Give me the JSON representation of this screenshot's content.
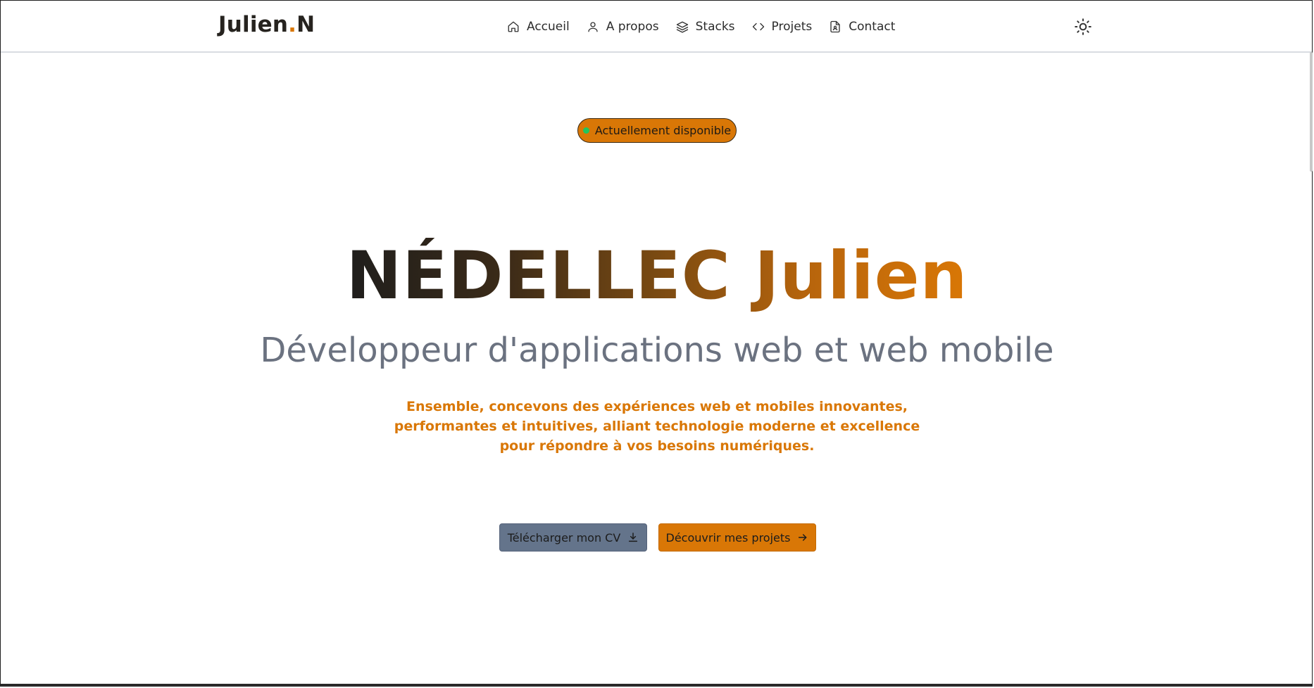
{
  "brand": {
    "name": "Julien",
    "dot": ".",
    "initial": "N"
  },
  "nav": {
    "items": [
      {
        "label": "Accueil",
        "icon": "home-icon"
      },
      {
        "label": "A propos",
        "icon": "user-icon"
      },
      {
        "label": "Stacks",
        "icon": "layers-icon"
      },
      {
        "label": "Projets",
        "icon": "code-icon"
      },
      {
        "label": "Contact",
        "icon": "file-user-icon"
      }
    ],
    "theme_toggle_icon": "sun-icon"
  },
  "badge": {
    "label": "Actuellement disponible",
    "status_color": "#22c55e"
  },
  "hero": {
    "title": "NÉDELLEC Julien",
    "subtitle": "Développeur d'applications web et web mobile",
    "description": "Ensemble, concevons des expériences web et mobiles innovantes, performantes et intuitives, alliant technologie moderne et excellence pour répondre à vos besoins numériques."
  },
  "actions": {
    "cv_label": "Télécharger mon CV",
    "cv_icon": "download-icon",
    "projects_label": "Découvrir mes projets",
    "projects_icon": "arrow-right-icon"
  },
  "colors": {
    "accent": "#d97706",
    "secondary_button": "#64748b",
    "subtitle": "#6b7280"
  }
}
